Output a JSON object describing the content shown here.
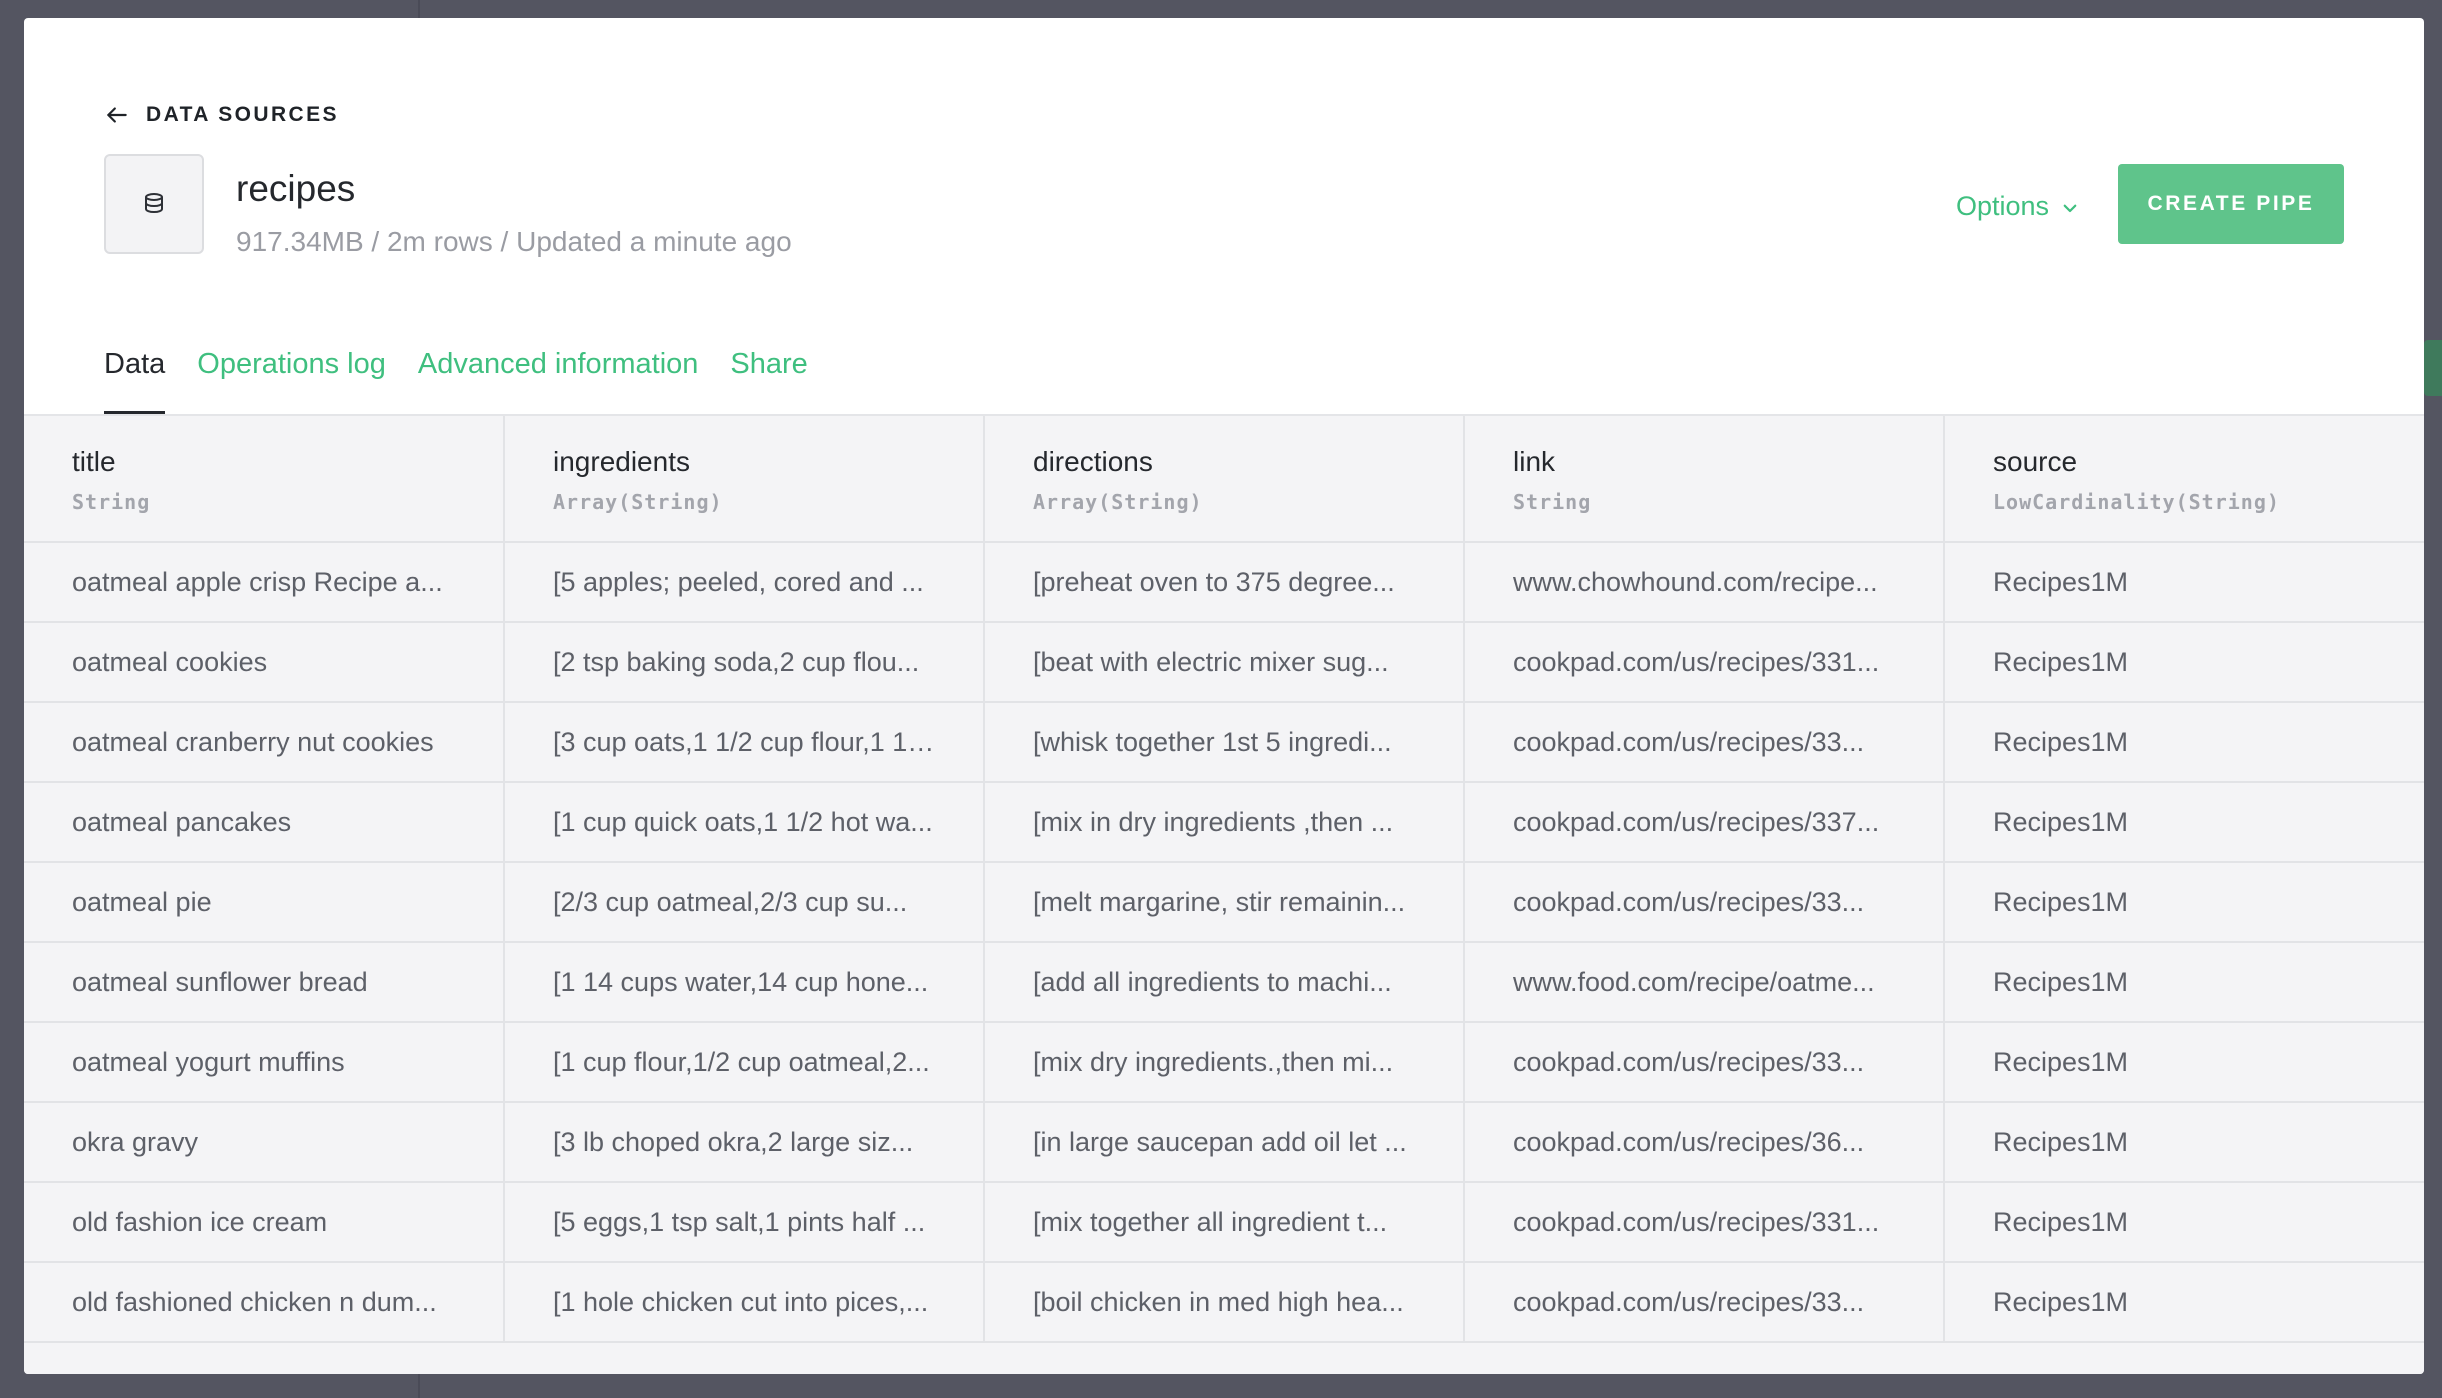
{
  "header": {
    "back_label": "DATA SOURCES",
    "title": "recipes",
    "meta": "917.34MB / 2m rows / Updated a minute ago",
    "options_label": "Options",
    "create_pipe_label": "CREATE PIPE"
  },
  "tabs": [
    {
      "label": "Data",
      "active": true
    },
    {
      "label": "Operations log",
      "active": false
    },
    {
      "label": "Advanced information",
      "active": false
    },
    {
      "label": "Share",
      "active": false
    }
  ],
  "table": {
    "columns": [
      {
        "name": "title",
        "type": "String"
      },
      {
        "name": "ingredients",
        "type": "Array(String)"
      },
      {
        "name": "directions",
        "type": "Array(String)"
      },
      {
        "name": "link",
        "type": "String"
      },
      {
        "name": "source",
        "type": "LowCardinality(String)"
      }
    ],
    "rows": [
      [
        "oatmeal apple crisp Recipe a...",
        "[5 apples; peeled, cored and ...",
        "[preheat oven to 375 degree...",
        "www.chowhound.com/recipe...",
        "Recipes1M"
      ],
      [
        "oatmeal cookies",
        "[2 tsp baking soda,2 cup flou...",
        "[beat with electric mixer sug...",
        "cookpad.com/us/recipes/331...",
        "Recipes1M"
      ],
      [
        "oatmeal cranberry nut cookies",
        "[3 cup oats,1 1/2 cup flour,1 1/...",
        "[whisk together 1st 5 ingredi...",
        "cookpad.com/us/recipes/33...",
        "Recipes1M"
      ],
      [
        "oatmeal pancakes",
        "[1 cup quick oats,1 1/2 hot wa...",
        "[mix in dry ingredients ,then ...",
        "cookpad.com/us/recipes/337...",
        "Recipes1M"
      ],
      [
        "oatmeal pie",
        "[2/3 cup oatmeal,2/3 cup su...",
        "[melt margarine, stir remainin...",
        "cookpad.com/us/recipes/33...",
        "Recipes1M"
      ],
      [
        "oatmeal sunflower bread",
        "[1 14 cups water,14 cup hone...",
        "[add all ingredients to machi...",
        "www.food.com/recipe/oatme...",
        "Recipes1M"
      ],
      [
        "oatmeal yogurt muffins",
        "[1 cup flour,1/2 cup oatmeal,2...",
        "[mix dry ingredients.,then mi...",
        "cookpad.com/us/recipes/33...",
        "Recipes1M"
      ],
      [
        "okra gravy",
        "[3 lb choped okra,2 large siz...",
        "[in large saucepan add oil let ...",
        "cookpad.com/us/recipes/36...",
        "Recipes1M"
      ],
      [
        "old fashion ice cream",
        "[5 eggs,1 tsp salt,1 pints half ...",
        "[mix together all ingredient t...",
        "cookpad.com/us/recipes/331...",
        "Recipes1M"
      ],
      [
        "old fashioned chicken n dum...",
        "[1 hole chicken cut into pices,...",
        "[boil chicken in med high hea...",
        "cookpad.com/us/recipes/33...",
        "Recipes1M"
      ]
    ]
  },
  "colors": {
    "accent": "#3fbf7f",
    "button_bg": "#5fc48b",
    "text_primary": "#25282d",
    "text_muted": "#9a9ca3"
  },
  "icons": {
    "back": "arrow-left-icon",
    "datasource": "database-icon",
    "options": "chevron-down-icon"
  }
}
